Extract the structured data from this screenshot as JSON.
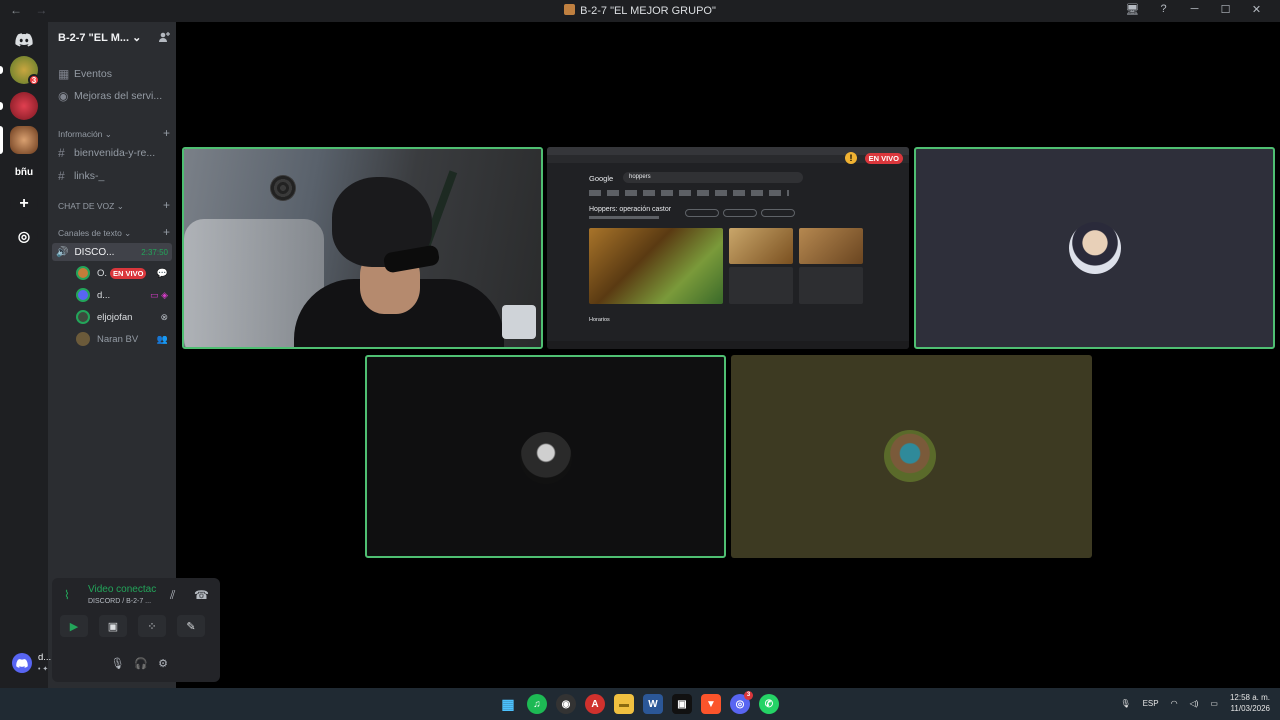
{
  "window": {
    "title": "B-2-7 \"EL MEJOR GRUPO\"",
    "nav_back": "←",
    "nav_forward": "→",
    "controls": [
      "🖥",
      "?",
      "─",
      "☐",
      "✕"
    ]
  },
  "servers": {
    "home_icon": "discord-logo-icon",
    "badge_count": "3",
    "text_server": "bñu",
    "add_icon": "+",
    "explore_icon": "◎"
  },
  "sidebar": {
    "server_name": "B-2-7 \"EL M...",
    "server_chevron": "⌄",
    "invite_icon": "person-add-icon",
    "items": [
      {
        "icon": "▦",
        "label": "Eventos"
      },
      {
        "icon": "◉",
        "label": "Mejoras del servi..."
      }
    ],
    "category_info": "Información",
    "text_channels": [
      {
        "icon": "#",
        "label": "bienvenida-y-re..."
      },
      {
        "icon": "#",
        "label": "links-_"
      }
    ],
    "category_voice": "CHAT DE VOZ",
    "category_text": "Canales de texto",
    "voice_channel": {
      "icon": "🔊",
      "label": "DISCO...",
      "timer": "2:37:50"
    },
    "voice_users": [
      {
        "name": "O.",
        "live": "EN VIVO",
        "right": "💬",
        "color": "#c27c3a"
      },
      {
        "name": "d...",
        "live": "",
        "right": "▭ ◈",
        "color": "#5865f2"
      },
      {
        "name": "eljojofan",
        "live": "",
        "right": "⊗",
        "color": "#3d4a3d"
      },
      {
        "name": "Naran BV",
        "live": "",
        "right": "👥",
        "color": "#6b5a3a"
      }
    ]
  },
  "voice_panel": {
    "status": "Video conectac",
    "subtitle": "DISCORD / B-2-7 ...",
    "signal_icon": "⌇",
    "noise_icon": "⫽",
    "disconnect_icon": "☎",
    "buttons": [
      "▶",
      "▣",
      "⁘",
      "✎"
    ]
  },
  "user_bar": {
    "name": "d...",
    "status": "• ✦",
    "mic_icon": "🎙",
    "headset_icon": "🎧",
    "settings_icon": "⚙"
  },
  "tiles": {
    "screen_share": {
      "live_label": "EN VIVO",
      "warn": "!",
      "google": "Google",
      "query": "hoppers",
      "result_title": "Hoppers: operación castor",
      "section": "Horarios"
    }
  },
  "taskbar": {
    "apps": [
      "▦",
      "♫",
      "◉",
      "A",
      "▬",
      "W",
      "▣",
      "▼",
      "◎",
      "✆"
    ],
    "discord_badge": "3",
    "lang": "ESP",
    "time": "12:58 a. m.",
    "date": "11/03/2026"
  }
}
